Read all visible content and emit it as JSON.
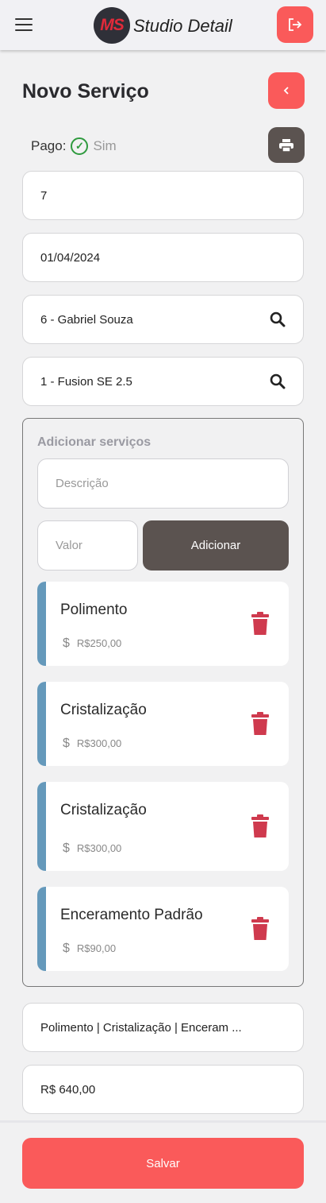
{
  "header": {
    "logo_text": "MS",
    "brand": "Studio Detail"
  },
  "page": {
    "title": "Novo Serviço",
    "paid_label": "Pago:",
    "paid_value": "Sim"
  },
  "fields": {
    "id": "7",
    "date": "01/04/2024",
    "client": "6 - Gabriel Souza",
    "vehicle": "1 - Fusion SE 2.5"
  },
  "services": {
    "title": "Adicionar serviços",
    "description_placeholder": "Descrição",
    "value_placeholder": "Valor",
    "add_label": "Adicionar",
    "items": [
      {
        "name": "Polimento",
        "price": "R$250,00"
      },
      {
        "name": "Cristalização",
        "price": "R$300,00"
      },
      {
        "name": "Cristalização",
        "price": "R$300,00"
      },
      {
        "name": "Enceramento Padrão",
        "price": "R$90,00"
      }
    ]
  },
  "summary": {
    "services": "Polimento | Cristalização | Enceram ...",
    "total": "R$ 640,00"
  },
  "footer": {
    "save_label": "Salvar"
  },
  "colors": {
    "accent": "#fa5a5a",
    "dark": "#5b5350",
    "card_bar": "#6599bb",
    "trash": "#cf3a4e",
    "paid": "#2e9a3e"
  }
}
